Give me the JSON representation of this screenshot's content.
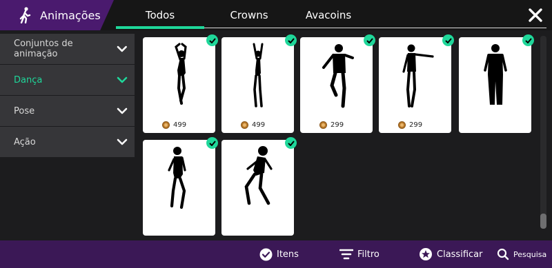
{
  "header": {
    "title": "Animações",
    "tabs": [
      {
        "label": "Todos",
        "active": true
      },
      {
        "label": "Crowns",
        "active": false
      },
      {
        "label": "Avacoins",
        "active": false
      }
    ],
    "icons": {
      "title": "walking-person-icon",
      "close": "close-icon"
    }
  },
  "sidebar": {
    "items": [
      {
        "label": "Conjuntos de animação",
        "active": false
      },
      {
        "label": "Dança",
        "active": true
      },
      {
        "label": "Pose",
        "active": false
      },
      {
        "label": "Ação",
        "active": false
      }
    ]
  },
  "cards": [
    {
      "price": "499",
      "checked": true
    },
    {
      "price": "499",
      "checked": true
    },
    {
      "price": "299",
      "checked": true
    },
    {
      "price": "299",
      "checked": true
    },
    {
      "price": "",
      "checked": true
    },
    {
      "price": "",
      "checked": true
    },
    {
      "price": "",
      "checked": true
    }
  ],
  "bottom_bar": {
    "items_label": "Itens",
    "filter_label": "Filtro",
    "sort_label": "Classificar",
    "search_label": "Pesquisa"
  },
  "colors": {
    "accent": "#1fd79a",
    "header_purple": "#4a1a6e",
    "bottom_purple": "#3b1856",
    "background": "#1c1c1e",
    "coin": "#b97a2a"
  }
}
